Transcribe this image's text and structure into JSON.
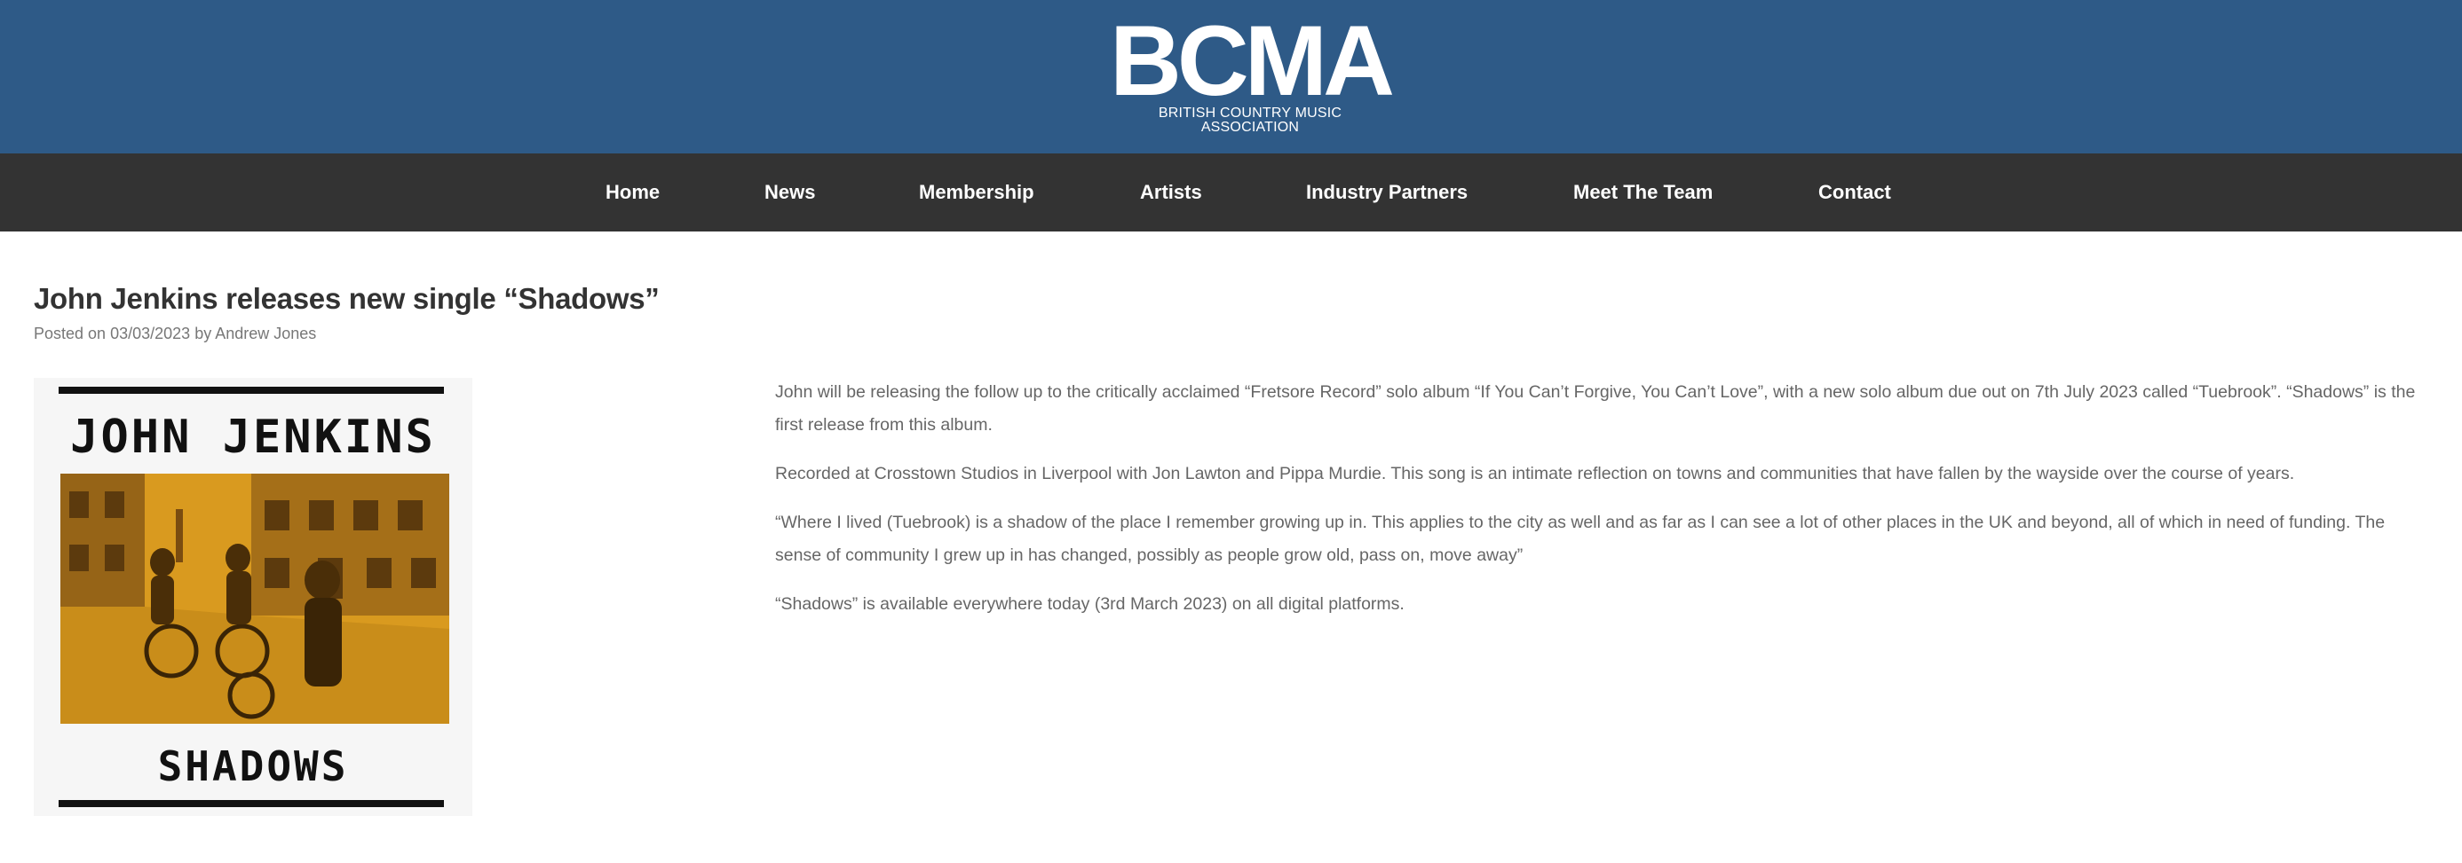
{
  "brand": {
    "name": "BCMA",
    "tagline": "BRITISH COUNTRY MUSIC ASSOCIATION",
    "header_color": "#2e5a87",
    "nav_color": "#333333"
  },
  "nav": [
    {
      "label": "Home"
    },
    {
      "label": "News"
    },
    {
      "label": "Membership"
    },
    {
      "label": "Artists"
    },
    {
      "label": "Industry Partners"
    },
    {
      "label": "Meet The Team"
    },
    {
      "label": "Contact"
    }
  ],
  "post": {
    "title": "John Jenkins releases new single “Shadows”",
    "meta_prefix": "Posted on",
    "date": "03/03/2023",
    "meta_by": "by",
    "author": "Andrew Jones",
    "image": {
      "artist": "JOHN JENKINS",
      "title": "SHADOWS"
    },
    "paragraphs": [
      "John will be releasing the follow up to the critically acclaimed “Fretsore Record” solo album “If You Can’t Forgive, You Can’t Love”, with a new solo album due out on 7th July 2023 called “Tuebrook”. “Shadows” is the first release from this album.",
      "Recorded at Crosstown Studios in Liverpool with Jon Lawton and Pippa Murdie. This song is an intimate reflection on towns and communities that have fallen by the wayside over the course of years.",
      "“Where I lived (Tuebrook) is a shadow of the place I remember growing up in. This applies to the city as well and as far as I can see a lot of other places in the UK and beyond, all of which in need of funding. The sense of community I grew up in has changed, possibly as people grow old, pass on, move away”",
      "“Shadows” is available everywhere today (3rd March 2023) on all digital platforms."
    ]
  }
}
